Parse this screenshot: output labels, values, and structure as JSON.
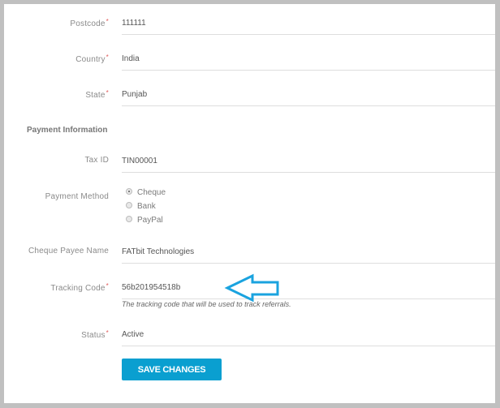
{
  "form": {
    "postcode": {
      "label": "Postcode",
      "required": true,
      "value": "111111"
    },
    "country": {
      "label": "Country",
      "required": true,
      "value": "India"
    },
    "state": {
      "label": "State",
      "required": true,
      "value": "Punjab"
    },
    "payment_section_title": "Payment Information",
    "tax_id": {
      "label": "Tax ID",
      "required": false,
      "value": "TIN00001"
    },
    "payment_method": {
      "label": "Payment Method",
      "options": [
        {
          "label": "Cheque",
          "checked": true
        },
        {
          "label": "Bank",
          "checked": false
        },
        {
          "label": "PayPal",
          "checked": false
        }
      ]
    },
    "cheque_payee": {
      "label": "Cheque Payee Name",
      "required": false,
      "value": "FATbit Technologies"
    },
    "tracking_code": {
      "label": "Tracking Code",
      "required": true,
      "value": "56b201954518b",
      "help": "The tracking code that will be used to track referrals."
    },
    "status": {
      "label": "Status",
      "required": true,
      "value": "Active"
    },
    "required_marker": "*",
    "save_label": "SAVE CHANGES"
  },
  "annotation": {
    "icon": "left-arrow-icon",
    "color": "#1aa3df"
  }
}
